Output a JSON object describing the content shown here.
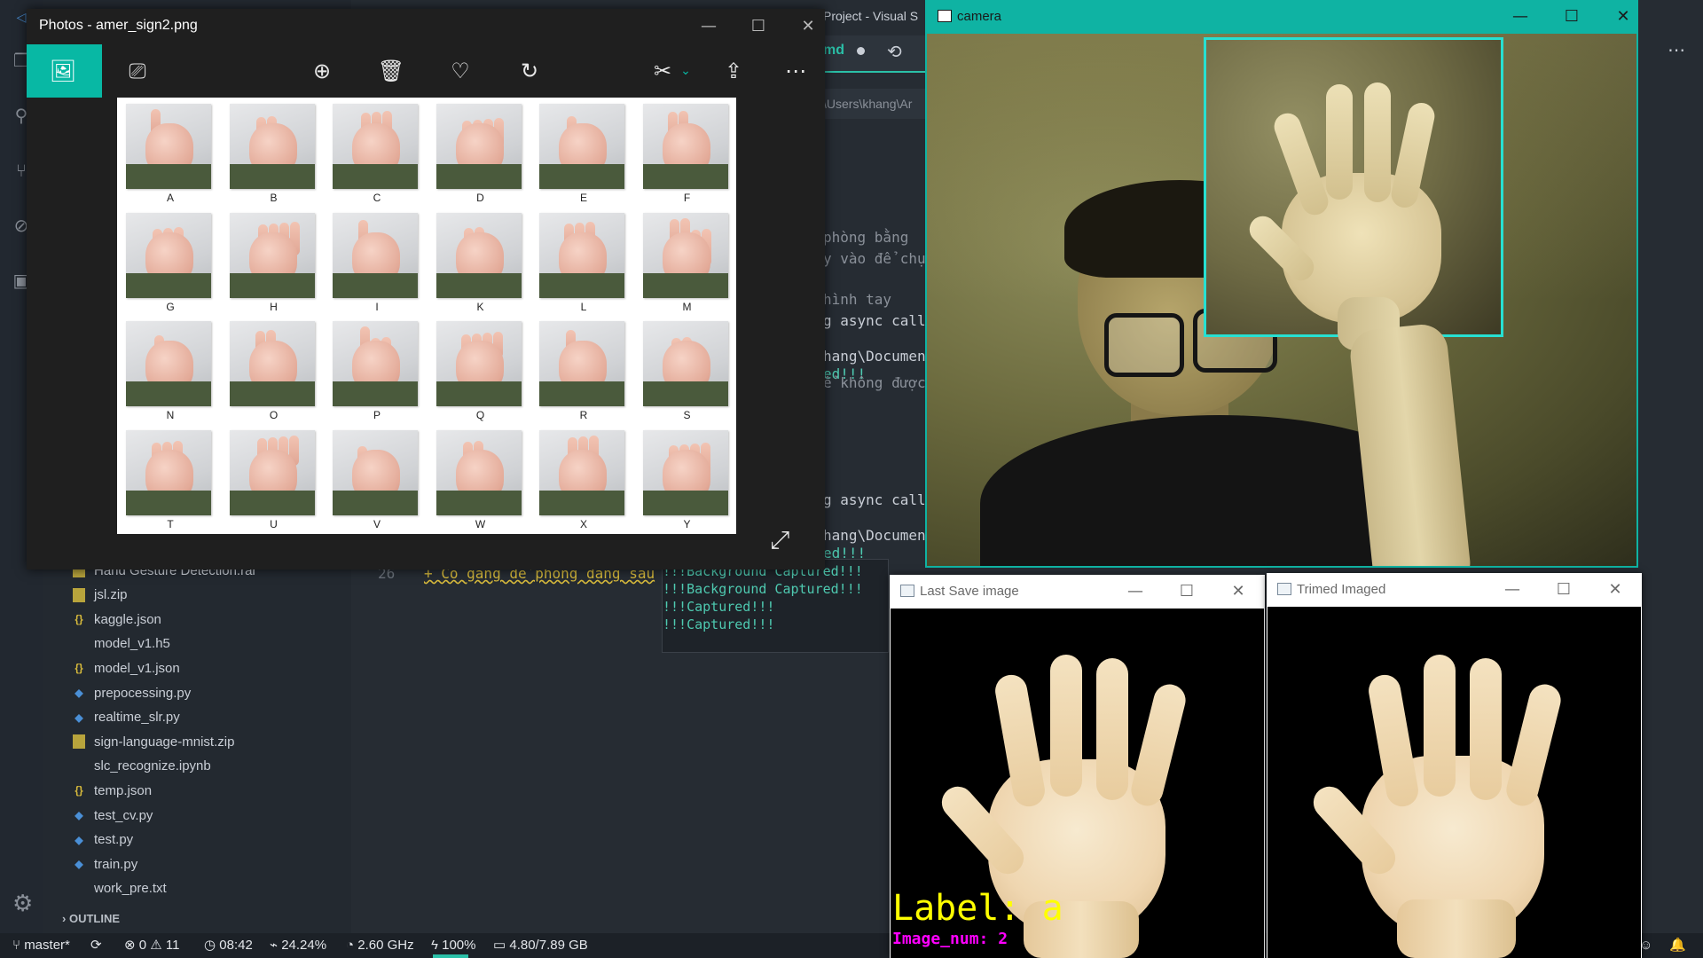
{
  "vscode": {
    "title_fragment": "Project - Visual S",
    "tab_label": "md",
    "breadcrumb_fragment": "\\Users\\khang\\Ar",
    "code_fragments": [
      "phòng bằng",
      "y vào để chụ",
      "hình tay",
      "g async callb",
      "hang\\Document",
      "ed!!!",
      "ể không được",
      "g async callb",
      "hang\\Document",
      "ed!!!"
    ],
    "line_number": "26",
    "line_26_text": "+ Cố gắng để phòng đằng sau",
    "terminal_lines": [
      "!!!Background Captured!!!",
      "!!!Background Captured!!!",
      "!!!Captured!!!",
      "!!!Captured!!!"
    ],
    "explorer_files": [
      {
        "name": "Hand Gesture Detection.rar",
        "icon": "zip-icon"
      },
      {
        "name": "jsl.zip",
        "icon": "zip-icon"
      },
      {
        "name": "kaggle.json",
        "icon": "json-icon"
      },
      {
        "name": "model_v1.h5",
        "icon": "file-icon"
      },
      {
        "name": "model_v1.json",
        "icon": "json-icon"
      },
      {
        "name": "prepocessing.py",
        "icon": "python-icon"
      },
      {
        "name": "realtime_slr.py",
        "icon": "python-icon"
      },
      {
        "name": "sign-language-mnist.zip",
        "icon": "zip-icon"
      },
      {
        "name": "slc_recognize.ipynb",
        "icon": "notebook-icon"
      },
      {
        "name": "temp.json",
        "icon": "json-icon"
      },
      {
        "name": "test_cv.py",
        "icon": "python-icon"
      },
      {
        "name": "test.py",
        "icon": "python-icon"
      },
      {
        "name": "train.py",
        "icon": "python-icon"
      },
      {
        "name": "work_pre.txt",
        "icon": "file-icon"
      }
    ],
    "outline_label": "OUTLINE",
    "status": {
      "branch": "master*",
      "errors": "0",
      "warnings": "11",
      "time": "08:42",
      "cpu": "24.24%",
      "freq": "2.60 GHz",
      "battery": "100%",
      "memory": "4.80/7.89 GB"
    }
  },
  "photos": {
    "title": "Photos - amer_sign2.png",
    "signs": [
      "A",
      "B",
      "C",
      "D",
      "E",
      "F",
      "G",
      "H",
      "I",
      "K",
      "L",
      "M",
      "N",
      "O",
      "P",
      "Q",
      "R",
      "S",
      "T",
      "U",
      "V",
      "W",
      "X",
      "Y"
    ]
  },
  "camera": {
    "title": "camera"
  },
  "last_save": {
    "title": "Last Save image",
    "label_text": "Label: a",
    "image_num_text": "Image_num: 2"
  },
  "trimmed": {
    "title": "Trimed Imaged"
  },
  "colors": {
    "accent_teal": "#08b8a4",
    "roi_box": "#27e0d2",
    "label_yellow": "#ffff00",
    "num_magenta": "#ff00ff"
  }
}
